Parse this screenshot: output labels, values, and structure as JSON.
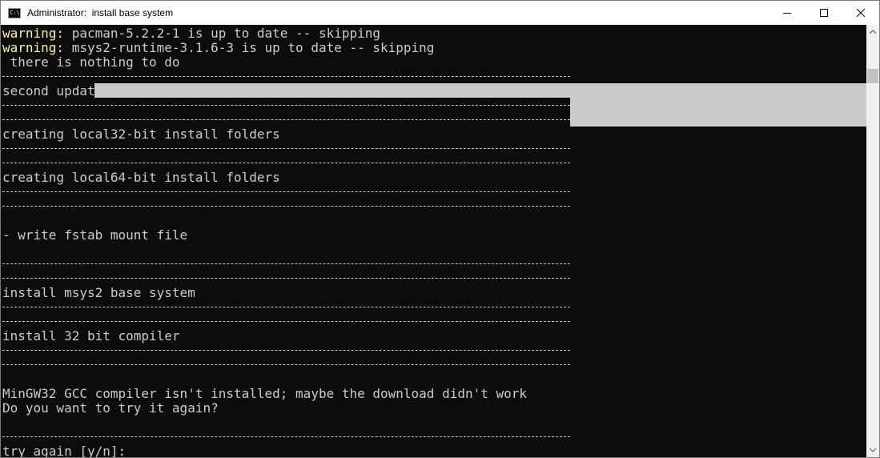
{
  "window": {
    "title": "Administrator:  install base system",
    "icon_text": "C:\\"
  },
  "controls": {
    "minimize": "minimize-icon",
    "maximize": "maximize-icon",
    "close": "close-icon"
  },
  "console": {
    "warn_label": "warning:",
    "lines": {
      "l1": " pacman-5.2.2-1 is up to date -- skipping",
      "l2": " msys2-runtime-3.1.6-3 is up to date -- skipping",
      "l3": " there is nothing to do",
      "l4": "second update",
      "l5": "creating local32-bit install folders",
      "l6": "creating local64-bit install folders",
      "l7": "- write fstab mount file",
      "l8": "install msys2 base system",
      "l9": "install 32 bit compiler",
      "l10": "MinGW32 GCC compiler isn't installed; maybe the download didn't work",
      "l11": "Do you want to try it again?",
      "l12": "try again [y/n]:"
    }
  },
  "colors": {
    "background": "#0c0c0c",
    "foreground": "#cccccc",
    "warning": "#f9f1a5",
    "selection": "#cccccc"
  }
}
